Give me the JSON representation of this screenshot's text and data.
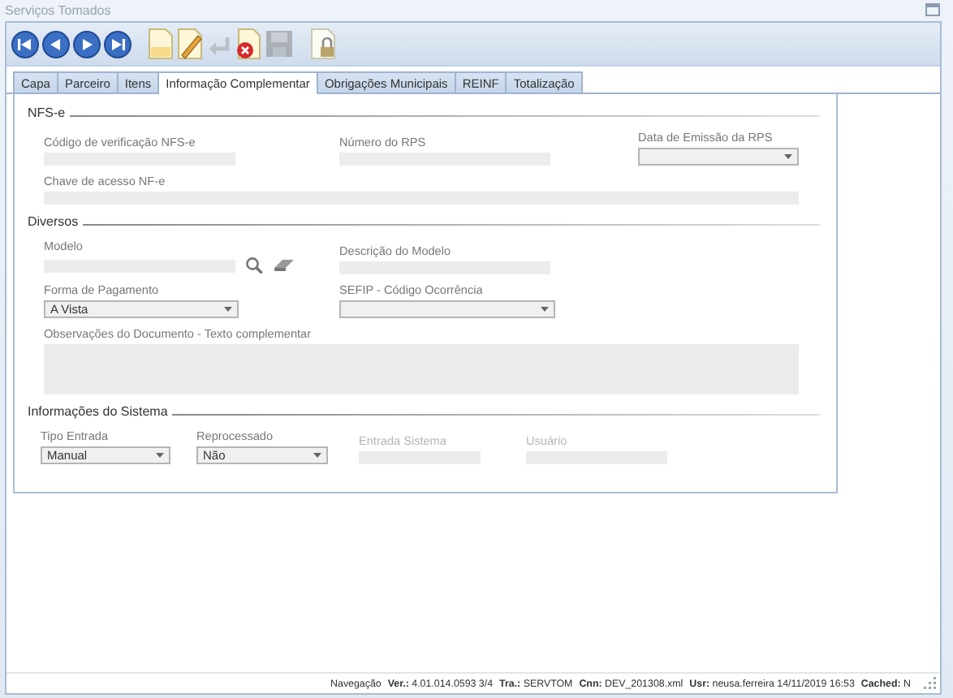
{
  "window": {
    "title": "Serviços Tomados"
  },
  "toolbar": [
    {
      "kind": "first",
      "disabled": false
    },
    {
      "kind": "prev",
      "disabled": false
    },
    {
      "kind": "next",
      "disabled": false
    },
    {
      "kind": "last",
      "disabled": false
    },
    {
      "kind": "new",
      "disabled": false
    },
    {
      "kind": "edit",
      "disabled": false
    },
    {
      "kind": "undo",
      "disabled": true
    },
    {
      "kind": "delete",
      "disabled": false
    },
    {
      "kind": "save",
      "disabled": true
    },
    {
      "kind": "lock",
      "disabled": false
    }
  ],
  "tabs": [
    {
      "label": "Capa",
      "selected": false
    },
    {
      "label": "Parceiro",
      "selected": false
    },
    {
      "label": "Itens",
      "selected": false
    },
    {
      "label": "Informação Complementar",
      "selected": true
    },
    {
      "label": "Obrigações Municipais",
      "selected": false
    },
    {
      "label": "REINF",
      "selected": false
    },
    {
      "label": "Totalização",
      "selected": false
    }
  ],
  "sections": [
    {
      "title": "NFS-e",
      "rows": [
        [
          {
            "kind": "text",
            "label": "Código de verificação NFS-e",
            "disabled": false
          },
          {
            "kind": "text",
            "label": "Número do RPS",
            "disabled": false
          },
          {
            "kind": "select",
            "label": "Data de Emissão da RPS",
            "disabled": false
          }
        ],
        [
          {
            "kind": "text",
            "label": "Chave de acesso NF-e",
            "disabled": false
          }
        ]
      ]
    },
    {
      "title": "Diversos",
      "rows": [
        [
          {
            "kind": "lookup",
            "label": "Modelo",
            "disabled": false
          },
          {
            "kind": "text",
            "label": "Descrição do Modelo",
            "disabled": false
          }
        ],
        [
          {
            "kind": "select",
            "label": "Forma de Pagamento",
            "value": "A Vista",
            "disabled": false
          },
          {
            "kind": "select",
            "label": "SEFIP - Código Ocorrência",
            "disabled": false
          }
        ],
        [
          {
            "kind": "textarea",
            "label": "Observações do Documento - Texto complementar",
            "disabled": false
          }
        ]
      ]
    },
    {
      "title": "Informações do Sistema",
      "rows": [
        [
          {
            "kind": "select",
            "label": "Tipo Entrada",
            "value": "Manual",
            "disabled": false
          },
          {
            "kind": "select",
            "label": "Reprocessado",
            "value": "Não",
            "disabled": false
          },
          {
            "kind": "text",
            "label": "Entrada Sistema",
            "disabled": true
          },
          {
            "kind": "text",
            "label": "Usuário",
            "disabled": true
          }
        ]
      ]
    }
  ],
  "status_bar": [
    {
      "label": "Navegação"
    },
    {
      "label": "Ver.:",
      "value": "4.01.014.0593 3/4"
    },
    {
      "label": "Tra.:",
      "value": "SERVTOM"
    },
    {
      "label": "Cnn:",
      "value": "DEV_201308.xml"
    },
    {
      "label": "Usr:",
      "value": "neusa.ferreira 14/11/2019 16:53"
    },
    {
      "label": "Cached:",
      "value": "N"
    }
  ]
}
